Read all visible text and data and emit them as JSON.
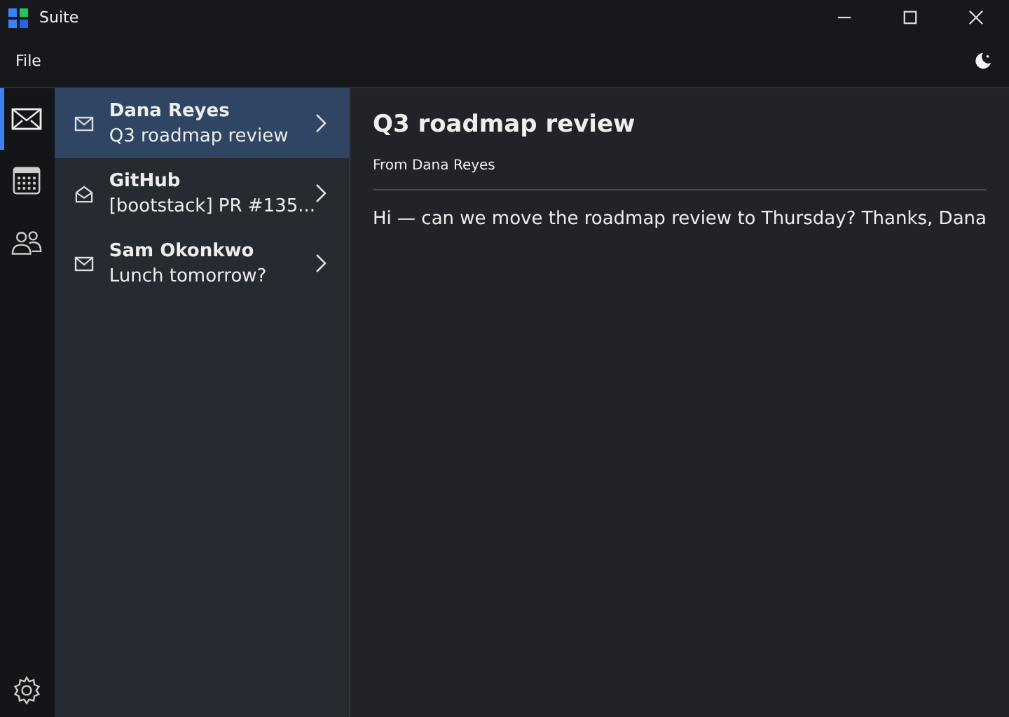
{
  "window": {
    "title": "Suite"
  },
  "menu": [
    "File"
  ],
  "rail": [
    {
      "kind": "mail",
      "selected": true
    },
    {
      "kind": "calendar",
      "selected": false
    },
    {
      "kind": "people",
      "selected": false
    }
  ],
  "messages": [
    {
      "sender": "Dana Reyes",
      "subject": "Q3 roadmap review",
      "read": false,
      "selected": true
    },
    {
      "sender": "GitHub",
      "subject": "[bootstack] PR #135...",
      "read": true,
      "selected": false
    },
    {
      "sender": "Sam Okonkwo",
      "subject": "Lunch tomorrow?",
      "read": false,
      "selected": false
    }
  ],
  "reader": {
    "title": "Q3 roadmap review",
    "from": "From Dana Reyes",
    "body": "Hi — can we move the roadmap review to Thursday? Thanks, Dana"
  }
}
